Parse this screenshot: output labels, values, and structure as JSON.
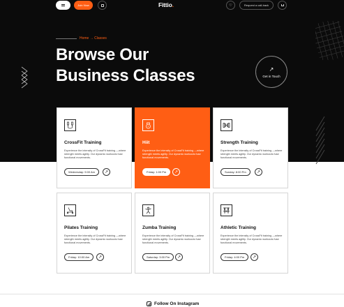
{
  "header": {
    "join_label": "Join Now",
    "logo_main": "Fittio",
    "logo_dot": ".",
    "callback_label": "Request a call-back"
  },
  "breadcrumb": "Home → Classes",
  "page_title": [
    "Browse Our",
    "Business Classes"
  ],
  "cta": {
    "arrow": "↗",
    "label": "Get in Touch"
  },
  "colors": {
    "accent": "#ff5e14",
    "hero_bg": "#0b0b0b"
  },
  "cards": [
    {
      "title": "CrossFit Training",
      "icon": "jump-rope-icon",
      "desc": "Experience the intensity of CrossFit training —where strength meets agility. Our dynamic workouts fuse functional movements.",
      "schedule": "Wednesday: 9:00 Am",
      "active": false
    },
    {
      "title": "Hiit",
      "icon": "kettlebell-icon",
      "desc": "Experience the intensity of CrossFit training —where strength meets agility. Our dynamic workouts fuse functional movements.",
      "schedule": "Friday: 1:00 Pm",
      "active": true
    },
    {
      "title": "Strength Training",
      "icon": "dumbbell-icon",
      "desc": "Experience the intensity of CrossFit training —where strength meets agility. Our dynamic workouts fuse functional movements.",
      "schedule": "Sunday: 8:00 Pm",
      "active": false
    },
    {
      "title": "Pilates Training",
      "icon": "treadmill-icon",
      "desc": "Experience the intensity of CrossFit training —where strength meets agility. Our dynamic workouts fuse functional movements.",
      "schedule": "Friday: 10:00 Am",
      "active": false
    },
    {
      "title": "Zumba Training",
      "icon": "dancer-icon",
      "desc": "Experience the intensity of CrossFit training —where strength meets agility. Our dynamic workouts fuse functional movements.",
      "schedule": "Saturday: 3:00 Pm",
      "active": false
    },
    {
      "title": "Athletic Training",
      "icon": "weight-bench-icon",
      "desc": "Experience the intensity of CrossFit training —where strength meets agility. Our dynamic workouts fuse functional movements.",
      "schedule": "Friday: 4:00 Pm",
      "active": false
    }
  ],
  "go_arrow": "↗",
  "footer": {
    "instagram_label": "Follow On Instagram"
  }
}
